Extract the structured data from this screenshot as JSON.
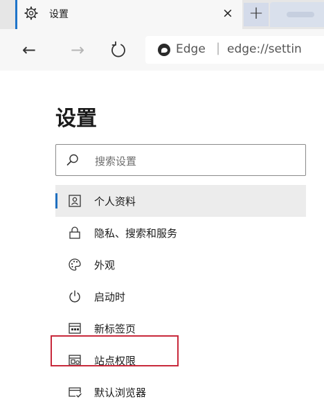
{
  "tab": {
    "title": "设置",
    "close_glyph": "×",
    "icon": "gear-icon"
  },
  "new_tab": {
    "glyph": "+"
  },
  "toolbar": {
    "back_glyph": "←",
    "forward_glyph": "→",
    "site_name": "Edge",
    "separator": "|",
    "url": "edge://settin"
  },
  "page": {
    "title": "设置",
    "search_placeholder": "搜索设置"
  },
  "nav": {
    "items": [
      {
        "label": "个人资料",
        "icon": "profile-icon",
        "selected": true
      },
      {
        "label": "隐私、搜索和服务",
        "icon": "lock-icon"
      },
      {
        "label": "外观",
        "icon": "palette-icon"
      },
      {
        "label": "启动时",
        "icon": "power-icon"
      },
      {
        "label": "新标签页",
        "icon": "new-tab-page-icon"
      },
      {
        "label": "站点权限",
        "icon": "site-permissions-icon",
        "highlighted": true
      },
      {
        "label": "默认浏览器",
        "icon": "default-browser-icon"
      }
    ]
  },
  "colors": {
    "accent": "#1f6fbf",
    "highlight_box": "#c8283a",
    "selected_bg": "#ececec"
  }
}
